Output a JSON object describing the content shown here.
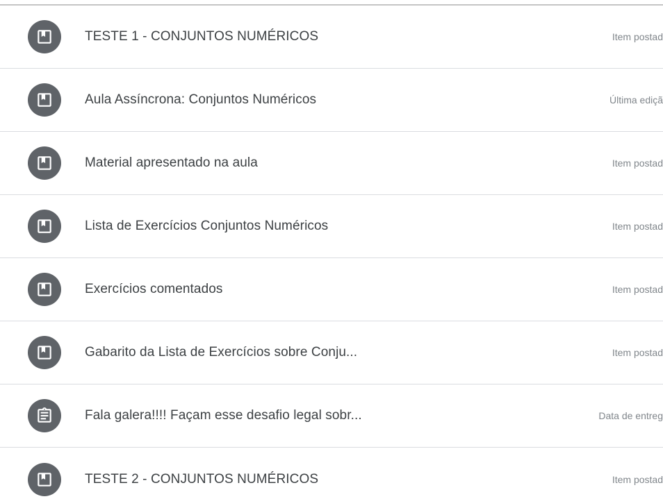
{
  "items": [
    {
      "icon": "material-icon",
      "title": "TESTE 1 - CONJUNTOS NUMÉRICOS",
      "meta": "Item postad"
    },
    {
      "icon": "material-icon",
      "title": "Aula Assíncrona: Conjuntos Numéricos",
      "meta": "Última ediçã"
    },
    {
      "icon": "material-icon",
      "title": "Material apresentado na aula",
      "meta": "Item postad"
    },
    {
      "icon": "material-icon",
      "title": "Lista de Exercícios Conjuntos Numéricos",
      "meta": "Item postad"
    },
    {
      "icon": "material-icon",
      "title": "Exercícios comentados",
      "meta": "Item postad"
    },
    {
      "icon": "material-icon",
      "title": "Gabarito da Lista de Exercícios sobre Conju...",
      "meta": "Item postad"
    },
    {
      "icon": "assignment-icon",
      "title": "Fala galera!!!! Façam esse desafio legal sobr...",
      "meta": "Data de entreg"
    },
    {
      "icon": "material-icon",
      "title": "TESTE 2 - CONJUNTOS NUMÉRICOS",
      "meta": "Item postad"
    }
  ],
  "colors": {
    "icon_bg": "#5f6368",
    "title": "#3c4043",
    "meta": "#80868b",
    "divider": "#dadce0"
  }
}
